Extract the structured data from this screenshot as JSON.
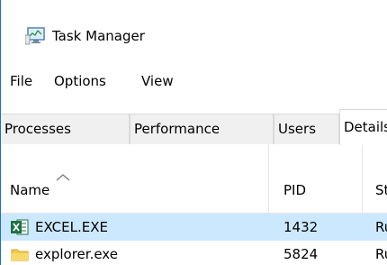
{
  "window": {
    "title": "Task Manager",
    "icon": "task-manager-icon"
  },
  "menu": {
    "items": [
      {
        "label": "File"
      },
      {
        "label": "Options"
      },
      {
        "label": "View"
      }
    ]
  },
  "tabs": [
    {
      "label": "Processes",
      "active": false
    },
    {
      "label": "Performance",
      "active": false
    },
    {
      "label": "Users",
      "active": false
    },
    {
      "label": "Details",
      "active": true
    }
  ],
  "table": {
    "sort_indicator": "sort-ascending-arrow",
    "columns": [
      {
        "label": "Name"
      },
      {
        "label": "PID"
      },
      {
        "label": "Status"
      }
    ],
    "rows": [
      {
        "name": "EXCEL.EXE",
        "pid": "1432",
        "status": "Running",
        "icon": "excel-icon",
        "selected": true
      },
      {
        "name": "explorer.exe",
        "pid": "5824",
        "status": "Running",
        "icon": "folder-icon",
        "selected": false
      }
    ]
  },
  "colors": {
    "selection": "#cce8ff",
    "window_border": "#1f6fbf",
    "excel_green": "#1e7145",
    "folder_yellow": "#f2c94c"
  }
}
